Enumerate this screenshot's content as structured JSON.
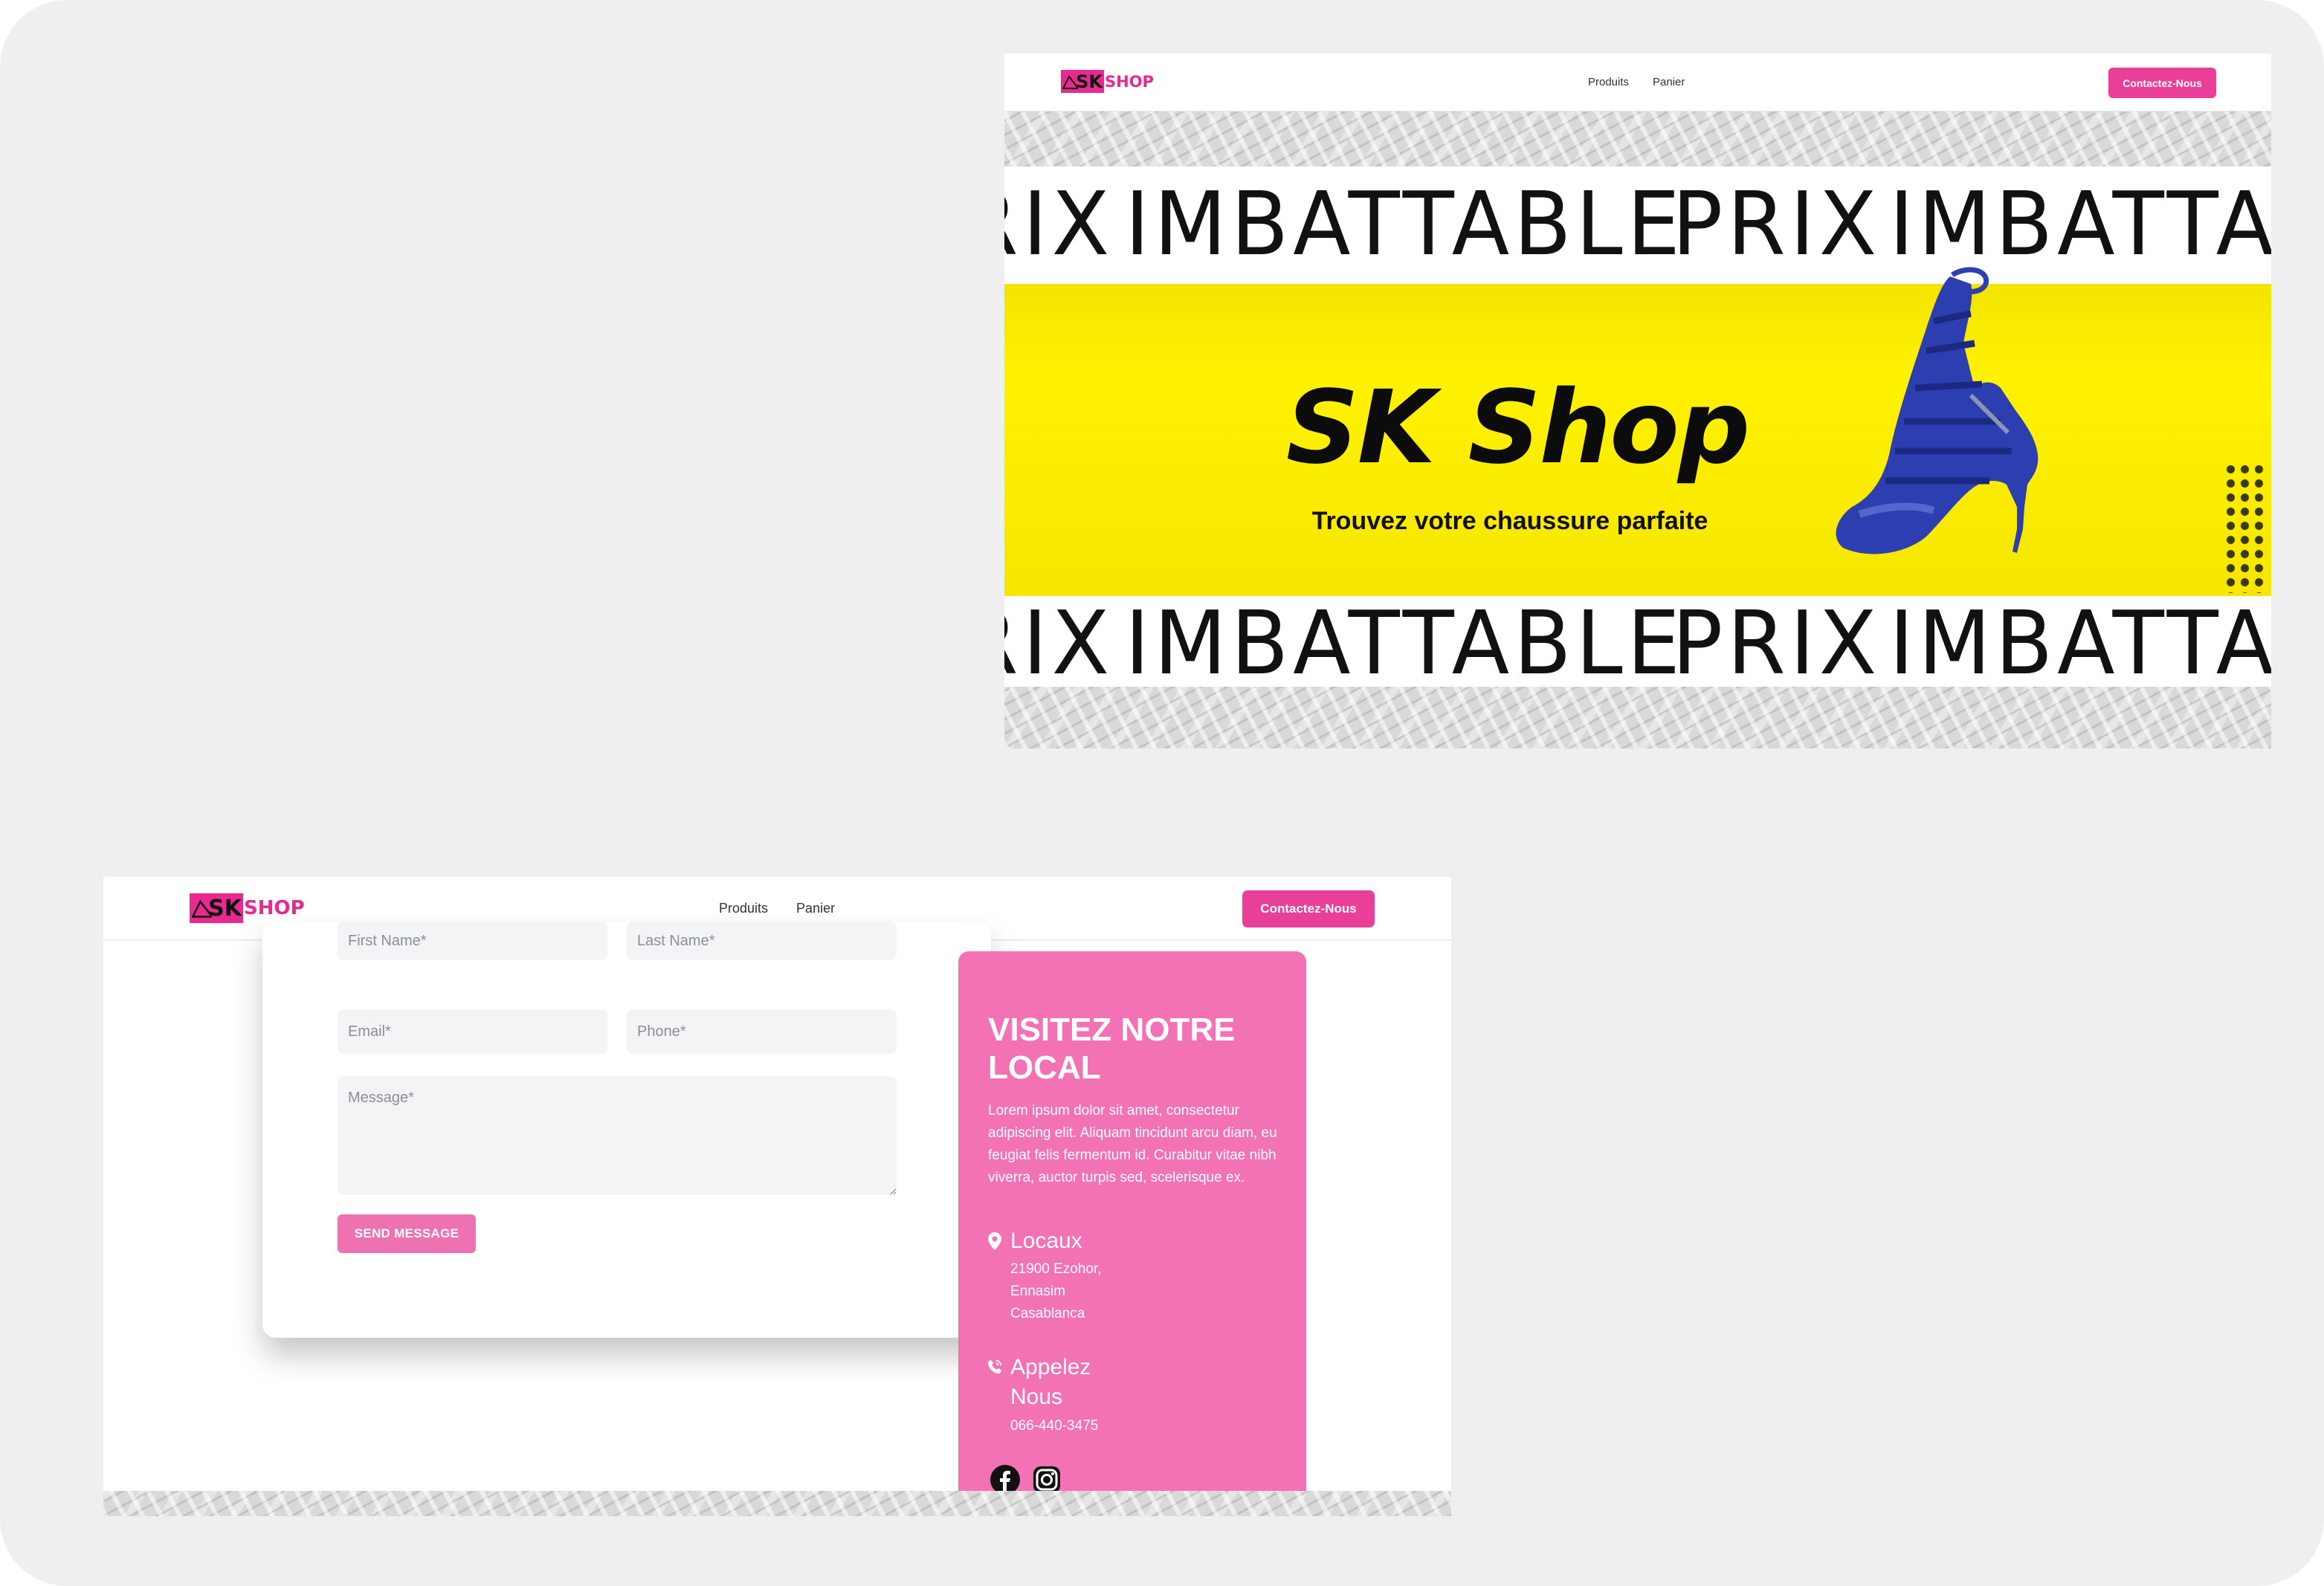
{
  "colors": {
    "brand_pink": "#ea3f98",
    "hero_yellow": "#fff200",
    "panel_pink": "#f272b5",
    "background": "#efefef"
  },
  "hero": {
    "logo": {
      "mark": "SK",
      "word": "SHOP"
    },
    "nav": [
      "Produits",
      "Panier"
    ],
    "cta": "Contactez-Nous",
    "band_top": [
      "RIX",
      "IMBATTABLE",
      "PRIX",
      "IMBATTABLE"
    ],
    "band_bottom": [
      "RIX",
      "IMBATTABLE",
      "PRIX",
      "IMBATTABLE"
    ],
    "title": "SK Shop",
    "subtitle": "Trouvez votre chaussure parfaite"
  },
  "contact": {
    "logo": {
      "mark": "SK",
      "word": "SHOP"
    },
    "nav": [
      "Produits",
      "Panier"
    ],
    "cta": "Contactez-Nous",
    "form": {
      "first_name": "First Name*",
      "last_name": "Last Name*",
      "email": "Email*",
      "phone": "Phone*",
      "message": "Message*",
      "submit": "SEND MESSAGE"
    },
    "panel": {
      "title": "VISITEZ NOTRE LOCAL",
      "text": "Lorem ipsum dolor sit amet, consectetur adipiscing elit. Aliquam tincidunt arcu diam, eu feugiat felis fermentum id. Curabitur vitae nibh viverra, auctor turpis sed, scelerisque ex.",
      "location_title": "Locaux",
      "address": [
        "21900 Ezohor,",
        "Ennasim",
        "Casablanca"
      ],
      "phone_title_1": "Appelez",
      "phone_title_2": "Nous",
      "phone": "066-440-3475",
      "social_icons": [
        "facebook-icon",
        "instagram-icon"
      ]
    }
  }
}
